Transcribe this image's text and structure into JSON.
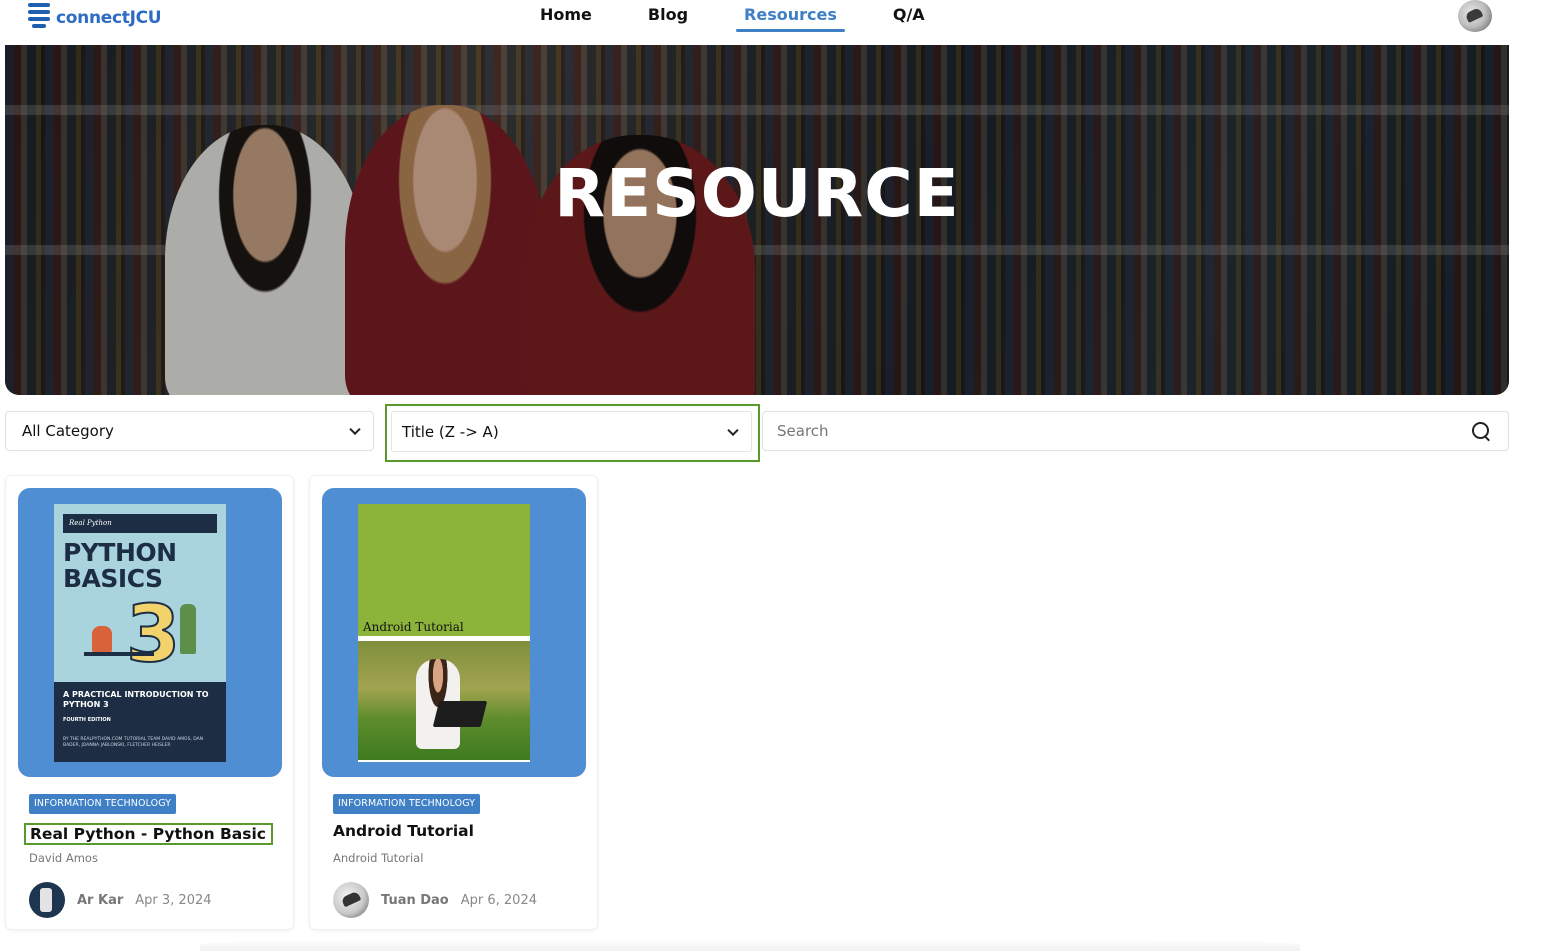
{
  "brand": {
    "name": "connectJCU"
  },
  "nav": {
    "items": [
      {
        "label": "Home",
        "active": false
      },
      {
        "label": "Blog",
        "active": false
      },
      {
        "label": "Resources",
        "active": true
      },
      {
        "label": "Q/A",
        "active": false
      }
    ]
  },
  "hero": {
    "title": "RESOURCE"
  },
  "filters": {
    "category": {
      "value": "All Category"
    },
    "sort": {
      "value": "Title (Z -> A)"
    },
    "search": {
      "placeholder": "Search",
      "value": ""
    }
  },
  "resources": [
    {
      "category": "INFORMATION TECHNOLOGY",
      "title": "Real Python - Python Basic",
      "author": "David Amos",
      "uploader": "Ar Kar",
      "date": "Apr 3, 2024",
      "cover": {
        "brand": "Real Python",
        "title_line1": "PYTHON",
        "title_line2": "BASICS",
        "big_number": "3",
        "subtitle": "A PRACTICAL INTRODUCTION TO PYTHON 3",
        "edition": "FOURTH EDITION",
        "credits": "BY THE REALPYTHON.COM TUTORIAL TEAM DAVID AMOS, DAN BADER, JOANNA JABLONSKI, FLETCHER HEISLER"
      }
    },
    {
      "category": "INFORMATION TECHNOLOGY",
      "title": "Android Tutorial",
      "author": "Android Tutorial",
      "uploader": "Tuan Dao",
      "date": "Apr 6, 2024",
      "cover": {
        "title": "Android Tutorial"
      }
    }
  ],
  "colors": {
    "accent": "#3f7fc5",
    "focus_outline": "#5a9a2c",
    "cover_bg": "#4f8ed2"
  }
}
